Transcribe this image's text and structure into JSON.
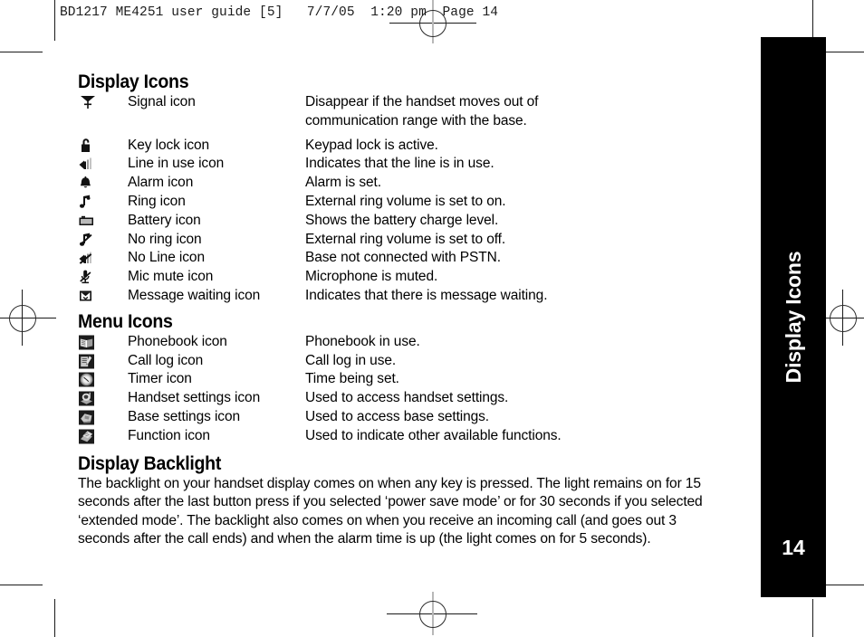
{
  "header": {
    "slug": "BD1217 ME4251 user guide [5]   7/7/05  1:20 pm  Page 14"
  },
  "tab": {
    "title": "Display Icons",
    "page_number": "14",
    "background_color": "#000000",
    "text_color": "#ffffff"
  },
  "sections": [
    {
      "heading": "Display Icons",
      "rows": [
        {
          "icon": "signal-icon",
          "name": "Signal icon",
          "desc": "Disappear if the handset moves out of\ncommunication range with the base."
        },
        {
          "icon": "key-lock-icon",
          "name": "Key lock icon",
          "desc": "Keypad lock is active."
        },
        {
          "icon": "line-in-use-icon",
          "name": "Line in use icon",
          "desc": "Indicates that the line is in use."
        },
        {
          "icon": "alarm-icon",
          "name": "Alarm icon",
          "desc": "Alarm is set."
        },
        {
          "icon": "ring-icon",
          "name": "Ring icon",
          "desc": "External ring volume is set to on."
        },
        {
          "icon": "battery-icon",
          "name": "Battery icon",
          "desc": "Shows the battery charge level."
        },
        {
          "icon": "no-ring-icon",
          "name": "No ring icon",
          "desc": "External ring volume is set to off."
        },
        {
          "icon": "no-line-icon",
          "name": "No Line icon",
          "desc": "Base not connected with PSTN."
        },
        {
          "icon": "mic-mute-icon",
          "name": "Mic mute icon",
          "desc": "Microphone is muted."
        },
        {
          "icon": "message-waiting-icon",
          "name": "Message waiting icon",
          "desc": "Indicates that there is message waiting."
        }
      ]
    },
    {
      "heading": "Menu Icons",
      "rows": [
        {
          "icon": "phonebook-icon",
          "name": "Phonebook icon",
          "desc": "Phonebook in use."
        },
        {
          "icon": "call-log-icon",
          "name": "Call log icon",
          "desc": "Call log in use."
        },
        {
          "icon": "timer-icon",
          "name": "Timer icon",
          "desc": "Time being set."
        },
        {
          "icon": "handset-settings-icon",
          "name": "Handset settings icon",
          "desc": "Used to access handset settings."
        },
        {
          "icon": "base-settings-icon",
          "name": "Base settings icon",
          "desc": "Used to access base settings."
        },
        {
          "icon": "function-icon",
          "name": "Function icon",
          "desc": "Used to indicate other available functions."
        }
      ]
    }
  ],
  "backlight": {
    "heading": "Display Backlight",
    "body": "The backlight on your handset display comes on when any key is pressed. The light remains on for 15 seconds after the last button press if you selected ‘power save mode’ or for 30 seconds if you  selected ‘extended mode’. The backlight also comes on when you receive an incoming call (and goes out 3 seconds after the call ends) and when the alarm time is up (the light comes on for 5 seconds)."
  }
}
